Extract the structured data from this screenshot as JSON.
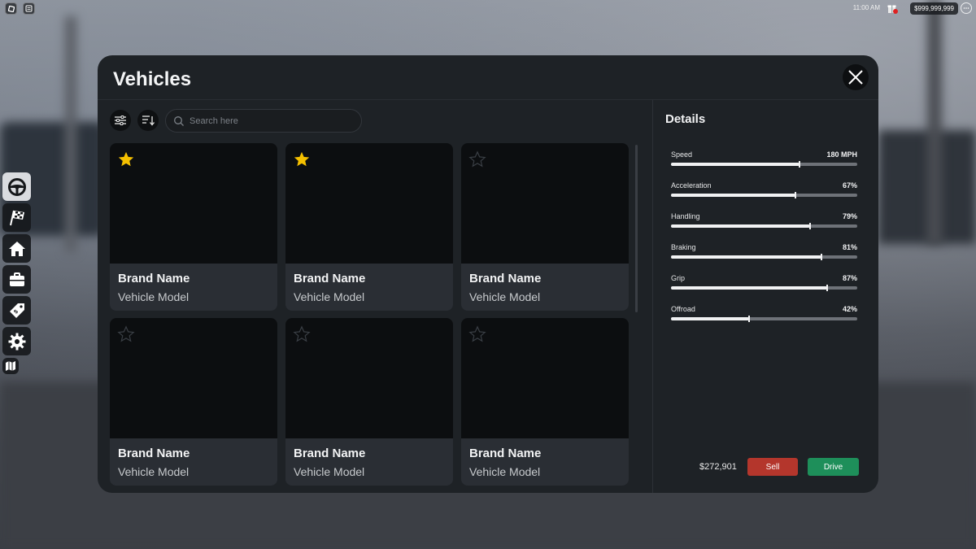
{
  "topbar": {
    "time": "11:00 AM",
    "money": "$999,999,999",
    "gift_badge": "1"
  },
  "sidebar": {
    "items": [
      {
        "name": "steering-wheel-icon",
        "active": true
      },
      {
        "name": "race-flag-icon",
        "active": false
      },
      {
        "name": "home-icon",
        "active": false
      },
      {
        "name": "briefcase-icon",
        "active": false
      },
      {
        "name": "price-tag-icon",
        "active": false
      },
      {
        "name": "gear-icon",
        "active": false
      },
      {
        "name": "map-icon",
        "active": false
      }
    ]
  },
  "panel": {
    "title": "Vehicles",
    "search_placeholder": "Search here"
  },
  "vehicles": [
    {
      "brand": "Brand Name",
      "model": "Vehicle Model",
      "favorite": true
    },
    {
      "brand": "Brand Name",
      "model": "Vehicle Model",
      "favorite": true
    },
    {
      "brand": "Brand Name",
      "model": "Vehicle Model",
      "favorite": false
    },
    {
      "brand": "Brand Name",
      "model": "Vehicle Model",
      "favorite": false
    },
    {
      "brand": "Brand Name",
      "model": "Vehicle Model",
      "favorite": false
    },
    {
      "brand": "Brand Name",
      "model": "Vehicle Model",
      "favorite": false
    }
  ],
  "details": {
    "title": "Details",
    "stats": [
      {
        "label": "Speed",
        "value": "180 MPH",
        "fill": 0.69
      },
      {
        "label": "Acceleration",
        "value": "67%",
        "fill": 0.67
      },
      {
        "label": "Handling",
        "value": "79%",
        "fill": 0.745
      },
      {
        "label": "Braking",
        "value": "81%",
        "fill": 0.81
      },
      {
        "label": "Grip",
        "value": "87%",
        "fill": 0.84
      },
      {
        "label": "Offroad",
        "value": "42%",
        "fill": 0.42
      }
    ],
    "price": "$272,901",
    "sell_label": "Sell",
    "drive_label": "Drive"
  },
  "colors": {
    "star_active": "#f5c000",
    "sell": "#b4362c",
    "drive": "#1e8f5a"
  }
}
